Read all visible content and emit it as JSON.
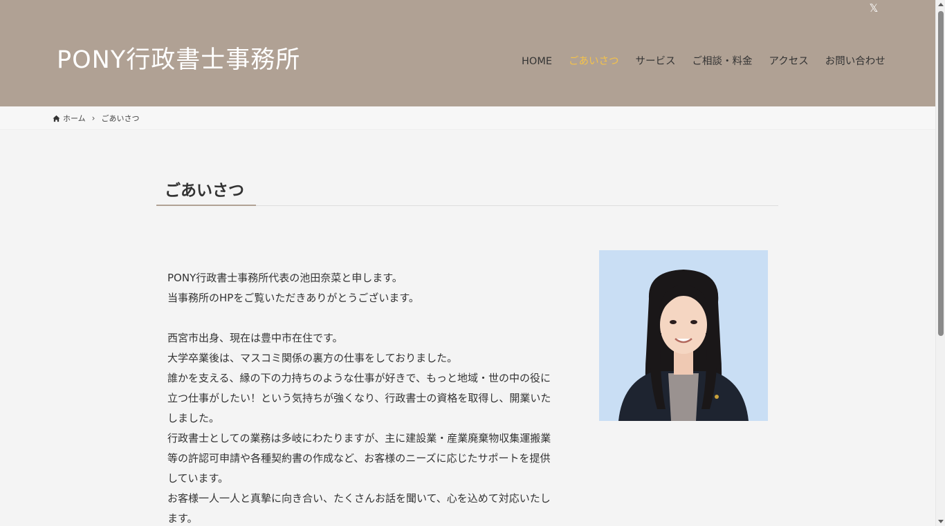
{
  "header": {
    "site_title": "PONY行政書士事務所",
    "social_x_label": "𝕏",
    "nav": [
      {
        "label": "HOME",
        "active": false
      },
      {
        "label": "ごあいさつ",
        "active": true
      },
      {
        "label": "サービス",
        "active": false
      },
      {
        "label": "ご相談・料金",
        "active": false
      },
      {
        "label": "アクセス",
        "active": false
      },
      {
        "label": "お問い合わせ",
        "active": false
      }
    ]
  },
  "breadcrumb": {
    "home_label": "ホーム",
    "separator": "›",
    "current": "ごあいさつ"
  },
  "main": {
    "page_title": "ごあいさつ",
    "paragraphs": [
      [
        "PONY行政書士事務所代表の池田奈菜と申します。",
        "当事務所のHPをご覧いただきありがとうございます。"
      ],
      [
        "西宮市出身、現在は豊中市在住です。",
        "大学卒業後は、マスコミ関係の裏方の仕事をしておりました。",
        "誰かを支える、縁の下の力持ちのような仕事が好きで、もっと地域・世の中の役に",
        "立つ仕事がしたい！という気持ちが強くなり、行政書士の資格を取得し、開業いた",
        "しました。",
        "行政書士としての業務は多岐にわたりますが、主に建設業・産業廃棄物収集運搬業",
        "等の許認可申請や各種契約書の作成など、お客様のニーズに応じたサポートを提供",
        "しています。",
        "お客様一人一人と真摯に向き合い、たくさんお話を聞いて、心を込めて対応いたし",
        "ます。"
      ]
    ]
  },
  "colors": {
    "header_bg": "#b0a194",
    "nav_active": "#f4c24a",
    "page_bg": "#f4f4f4",
    "portrait_bg": "#c9def4"
  }
}
